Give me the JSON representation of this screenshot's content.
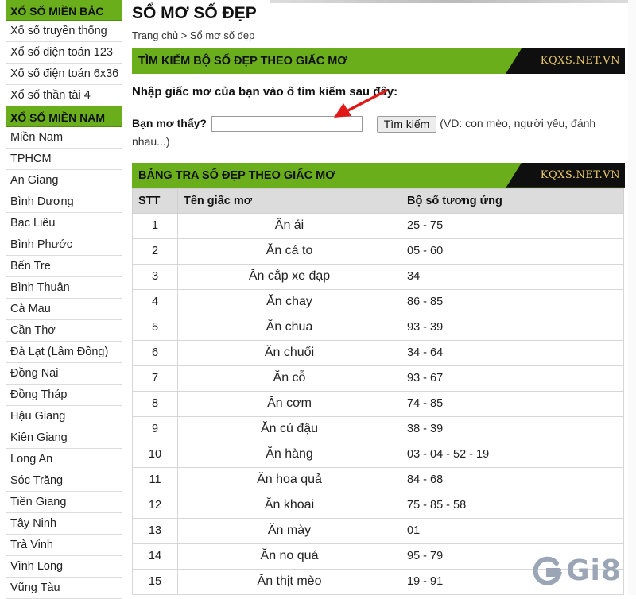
{
  "sidebar": {
    "sections": [
      {
        "heading": "XỔ SỐ MIỀN BẮC",
        "items": [
          "Xổ số truyền thống",
          "Xổ số điện toán 123",
          "Xổ số điện toán 6x36",
          "Xổ số thần tài 4"
        ]
      },
      {
        "heading": "XỔ SỐ MIỀN NAM",
        "items": [
          "Miền Nam",
          "TPHCM",
          "An Giang",
          "Bình Dương",
          "Bạc Liêu",
          "Bình Phước",
          "Bến Tre",
          "Bình Thuận",
          "Cà Mau",
          "Cần Thơ",
          "Đà Lạt (Lâm Đồng)",
          "Đồng Nai",
          "Đồng Tháp",
          "Hậu Giang",
          "Kiên Giang",
          "Long An",
          "Sóc Trăng",
          "Tiền Giang",
          "Tây Ninh",
          "Trà Vinh",
          "Vĩnh Long",
          "Vũng Tàu"
        ]
      }
    ]
  },
  "main": {
    "title": "SỔ MƠ SỐ ĐẸP",
    "breadcrumb": "Trang chủ > Sổ mơ số đẹp",
    "search_section": {
      "title": "TÌM KIẾM BỘ SỐ ĐẸP THEO GIẤC MƠ",
      "logo": "KQXS.NET.VN",
      "instruction": "Nhập giấc mơ của bạn vào ô tìm kiếm sau đây:",
      "label": "Bạn mơ thấy?",
      "input_value": "",
      "button_label": "Tìm kiếm",
      "hint": "(VD: con mèo, người yêu, đánh nhau...)"
    },
    "table_section": {
      "title": "BẢNG TRA SỐ ĐẸP THEO GIẤC MƠ",
      "logo": "KQXS.NET.VN",
      "columns": [
        "STT",
        "Tên giấc mơ",
        "Bộ số tương ứng"
      ],
      "rows": [
        [
          "1",
          "Ân ái",
          "25 - 75"
        ],
        [
          "2",
          "Ăn cá to",
          "05 - 60"
        ],
        [
          "3",
          "Ăn cắp xe đạp",
          "34"
        ],
        [
          "4",
          "Ăn chay",
          "86 - 85"
        ],
        [
          "5",
          "Ăn chua",
          "93 - 39"
        ],
        [
          "6",
          "Ăn chuối",
          "34 - 64"
        ],
        [
          "7",
          "Ăn cỗ",
          "93 - 67"
        ],
        [
          "8",
          "Ăn cơm",
          "74 - 85"
        ],
        [
          "9",
          "Ăn củ đậu",
          "38 - 39"
        ],
        [
          "10",
          "Ăn hàng",
          "03 - 04 - 52 - 19"
        ],
        [
          "11",
          "Ăn hoa quả",
          "84 - 68"
        ],
        [
          "12",
          "Ăn khoai",
          "75 - 85 - 58"
        ],
        [
          "13",
          "Ăn mày",
          "01"
        ],
        [
          "14",
          "Ăn no quá",
          "95 - 79"
        ],
        [
          "15",
          "Ăn thịt mèo",
          "19 - 91"
        ]
      ]
    }
  },
  "watermark": {
    "text": "Gi8",
    "icon": "g-logo-icon"
  },
  "colors": {
    "accent_green": "#6aae1c",
    "logo_bg": "#0f0f0f",
    "logo_text": "#e9c86a",
    "arrow": "#e01818"
  }
}
